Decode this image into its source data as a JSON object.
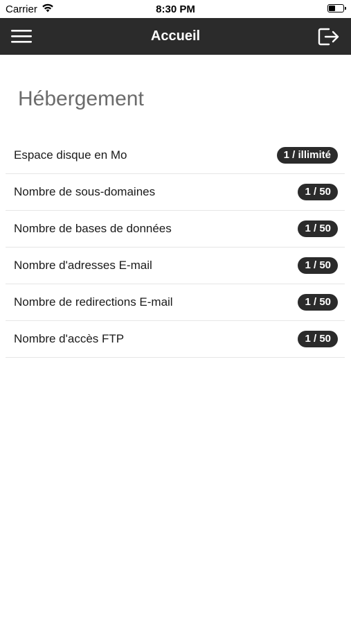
{
  "status_bar": {
    "carrier": "Carrier",
    "time": "8:30 PM"
  },
  "nav": {
    "title": "Accueil",
    "menu_icon": "hamburger-menu-icon",
    "logout_icon": "logout-icon"
  },
  "section": {
    "title": "Hébergement"
  },
  "items": [
    {
      "label": "Espace disque en Mo",
      "value": "1 / illimité"
    },
    {
      "label": "Nombre de sous-domaines",
      "value": "1 / 50"
    },
    {
      "label": "Nombre de bases de données",
      "value": "1 / 50"
    },
    {
      "label": "Nombre d'adresses E-mail",
      "value": "1 / 50"
    },
    {
      "label": "Nombre de redirections E-mail",
      "value": "1 / 50"
    },
    {
      "label": "Nombre d'accès FTP",
      "value": "1 / 50"
    }
  ],
  "colors": {
    "nav_background": "#2b2b2b",
    "badge_background": "#2b2b2b",
    "section_title": "#6b6b6b"
  }
}
